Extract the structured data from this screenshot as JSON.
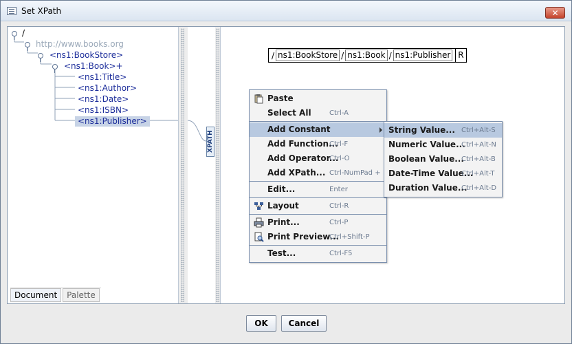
{
  "window": {
    "title": "Set XPath",
    "close_label": "✕"
  },
  "tree": {
    "root": "/",
    "namespace": "http://www.books.org",
    "bookstore": "<ns1:BookStore>",
    "book": "<ns1:Book>+",
    "children": [
      "<ns1:Title>",
      "<ns1:Author>",
      "<ns1:Date>",
      "<ns1:ISBN>",
      "<ns1:Publisher>"
    ]
  },
  "tabs": [
    "Document",
    "Palette"
  ],
  "xpath_tab": "XPATH",
  "xpath_bar": {
    "segments": [
      "ns1:BookStore",
      "ns1:Book",
      "ns1:Publisher"
    ],
    "separator": "/",
    "end_label": "R"
  },
  "context_menu": [
    {
      "label": "Paste",
      "accel": "",
      "icon": "paste-icon"
    },
    {
      "label": "Select All",
      "accel": "Ctrl-A"
    },
    {
      "label": "Add Constant",
      "accel": "",
      "submenu": true,
      "highlighted": true
    },
    {
      "label": "Add Function...",
      "accel": "Ctrl-F"
    },
    {
      "label": "Add Operator...",
      "accel": "Ctrl-O"
    },
    {
      "label": "Add XPath...",
      "accel": "Ctrl-NumPad +"
    },
    {
      "label": "Edit...",
      "accel": "Enter"
    },
    {
      "label": "Layout",
      "accel": "Ctrl-R",
      "icon": "layout-icon"
    },
    {
      "label": "Print...",
      "accel": "Ctrl-P",
      "icon": "print-icon"
    },
    {
      "label": "Print Preview...",
      "accel": "Ctrl+Shift-P",
      "icon": "print-preview-icon"
    },
    {
      "label": "Test...",
      "accel": "Ctrl-F5"
    }
  ],
  "submenu": [
    {
      "label": "String Value...",
      "accel": "Ctrl+Alt-S",
      "highlighted": true
    },
    {
      "label": "Numeric Value...",
      "accel": "Ctrl+Alt-N"
    },
    {
      "label": "Boolean Value...",
      "accel": "Ctrl+Alt-B"
    },
    {
      "label": "Date-Time Value...",
      "accel": "Ctrl+Alt-T"
    },
    {
      "label": "Duration Value...",
      "accel": "Ctrl+Alt-D"
    }
  ],
  "buttons": {
    "ok": "OK",
    "cancel": "Cancel"
  }
}
